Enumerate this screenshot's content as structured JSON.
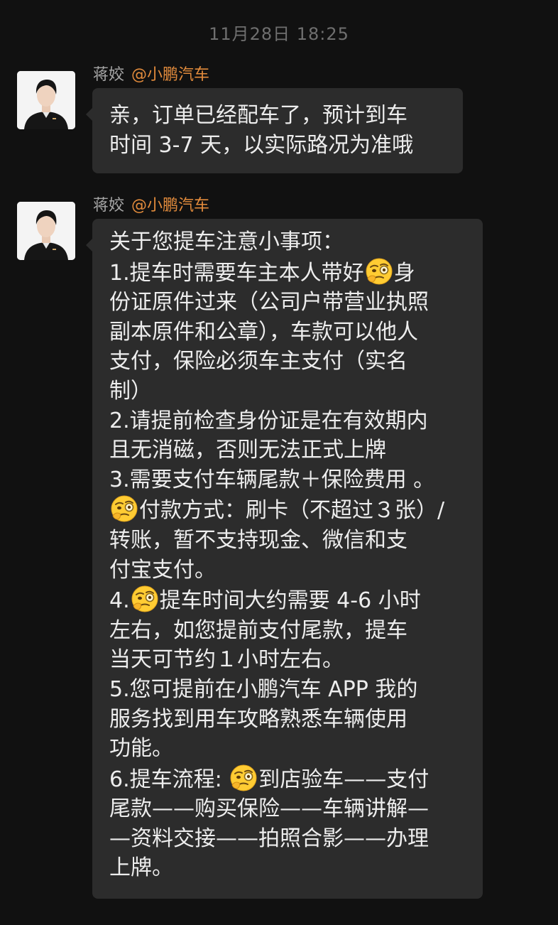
{
  "timestamp": "11月28日 18:25",
  "messages": [
    {
      "sender_name": "蒋姣",
      "sender_company": "@小鹏汽车",
      "lines": [
        [
          {
            "t": "亲，订单已经配车了，预计到车"
          }
        ],
        [
          {
            "t": "时间 3-7 天，以实际路况为准哦"
          }
        ]
      ]
    },
    {
      "sender_name": "蒋姣",
      "sender_company": "@小鹏汽车",
      "lines": [
        [
          {
            "t": "关于您提车注意小事项："
          }
        ],
        [
          {
            "t": "1.提车时需要车主本人带好"
          },
          {
            "emoji": "thinking-face-emoji"
          },
          {
            "t": "身"
          }
        ],
        [
          {
            "t": "份证原件过来（公司户带营业执照"
          }
        ],
        [
          {
            "t": "副本原件和公章），车款可以他人"
          }
        ],
        [
          {
            "t": "支付，保险必须车主支付（实名"
          }
        ],
        [
          {
            "t": "制）"
          }
        ],
        [
          {
            "t": "2.请提前检查身份证是在有效期内"
          }
        ],
        [
          {
            "t": "且无消磁，否则无法正式上牌"
          }
        ],
        [
          {
            "t": "3.需要支付车辆尾款＋保险费用 。"
          }
        ],
        [
          {
            "emoji": "thinking-face-emoji"
          },
          {
            "t": "付款方式：刷卡（不超过３张）/"
          }
        ],
        [
          {
            "t": "转账，暂不支持现金、微信和支"
          }
        ],
        [
          {
            "t": "付宝支付。"
          }
        ],
        [
          {
            "t": "4."
          },
          {
            "emoji": "thinking-face-emoji"
          },
          {
            "t": "提车时间大约需要 4-6 小时"
          }
        ],
        [
          {
            "t": "左右，如您提前支付尾款，提车"
          }
        ],
        [
          {
            "t": "当天可节约１小时左右。"
          }
        ],
        [
          {
            "t": "5.您可提前在小鹏汽车 APP 我的"
          }
        ],
        [
          {
            "t": "服务找到用车攻略熟悉车辆使用"
          }
        ],
        [
          {
            "t": "功能。"
          }
        ],
        [
          {
            "t": "6.提车流程: "
          },
          {
            "emoji": "thinking-face-emoji"
          },
          {
            "t": "到店验车——支付"
          }
        ],
        [
          {
            "t": "尾款——购买保险——车辆讲解—"
          }
        ],
        [
          {
            "t": "—资料交接——拍照合影——办理"
          }
        ],
        [
          {
            "t": "上牌。"
          }
        ]
      ]
    }
  ],
  "colors": {
    "background": "#111111",
    "bubble": "#2c2c2c",
    "company_accent": "#e28b3c",
    "sender_name": "#a6a6a6",
    "timestamp": "#6f6f6f"
  }
}
